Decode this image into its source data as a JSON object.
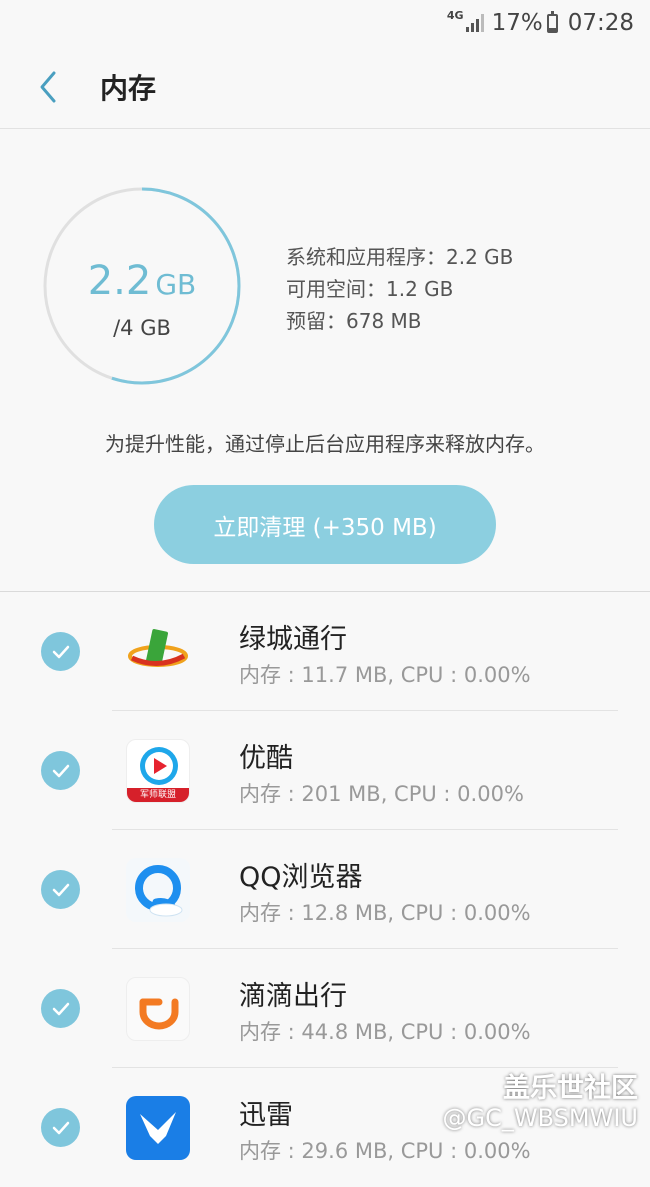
{
  "status_bar": {
    "network": "4G",
    "battery": "17%",
    "time": "07:28"
  },
  "header": {
    "title": "内存"
  },
  "memory": {
    "used_value": "2.2",
    "used_unit": "GB",
    "total": "/4 GB",
    "used_fraction": 0.55,
    "system_apps": "系统和应用程序：2.2 GB",
    "available": "可用空间：1.2 GB",
    "reserved": "预留：678 MB"
  },
  "hint": "为提升性能，通过停止后台应用程序来释放内存。",
  "clean_button": "立即清理 (+350 MB)",
  "apps": [
    {
      "name": "绿城通行",
      "meta": "内存 : 11.7 MB, CPU : 0.00%",
      "icon": "lvcheng-app-icon"
    },
    {
      "name": "优酷",
      "meta": "内存 : 201 MB, CPU : 0.00%",
      "icon": "youku-app-icon",
      "icon_label": "军师联盟"
    },
    {
      "name": "QQ浏览器",
      "meta": "内存 : 12.8 MB, CPU : 0.00%",
      "icon": "qq-browser-app-icon"
    },
    {
      "name": "滴滴出行",
      "meta": "内存 : 44.8 MB, CPU : 0.00%",
      "icon": "didi-app-icon"
    },
    {
      "name": "迅雷",
      "meta": "内存 : 29.6 MB, CPU : 0.00%",
      "icon": "xunlei-app-icon"
    }
  ],
  "watermark": {
    "brand": "盖乐世社区",
    "user": "@GC_WBSMWIU"
  },
  "colors": {
    "accent": "#7fc6dc",
    "button": "#8ccfe0",
    "ring_track": "#e0e0e0"
  }
}
